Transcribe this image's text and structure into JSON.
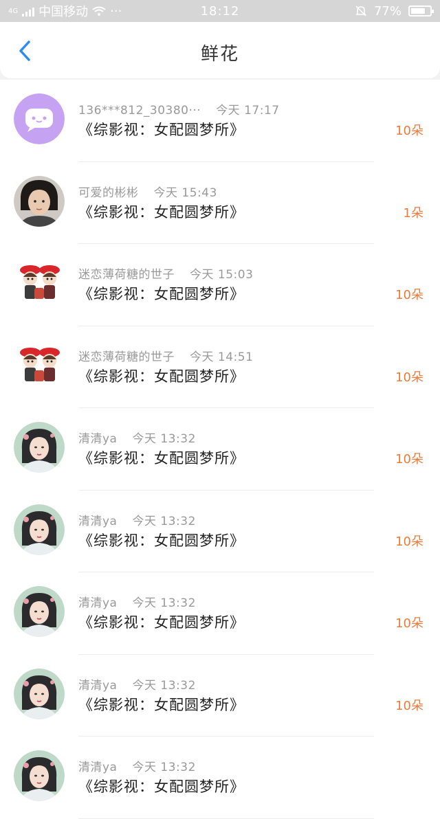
{
  "status_bar": {
    "network": "4G",
    "carrier": "中国移动",
    "dots": "···",
    "time": "18:12",
    "battery": "77%",
    "battery_level": 0.77
  },
  "header": {
    "title": "鲜花"
  },
  "records": [
    {
      "user": "136***812_30380···",
      "time": "今天 17:17",
      "book": "《综影视：女配圆梦所》",
      "count": "10朵",
      "avatar": "chat-bubble-avatar"
    },
    {
      "user": "可爱的彬彬",
      "time": "今天 15:43",
      "book": "《综影视：女配圆梦所》",
      "count": "1朵",
      "avatar": "user-photo-avatar"
    },
    {
      "user": "迷恋薄荷糖的世子",
      "time": "今天 15:03",
      "book": "《综影视：女配圆梦所》",
      "count": "10朵",
      "avatar": "cartoon-characters-avatar"
    },
    {
      "user": "迷恋薄荷糖的世子",
      "time": "今天 14:51",
      "book": "《综影视：女配圆梦所》",
      "count": "10朵",
      "avatar": "cartoon-characters-avatar"
    },
    {
      "user": "清清ya",
      "time": "今天 13:32",
      "book": "《综影视：女配圆梦所》",
      "count": "10朵",
      "avatar": "painted-lady-avatar"
    },
    {
      "user": "清清ya",
      "time": "今天 13:32",
      "book": "《综影视：女配圆梦所》",
      "count": "10朵",
      "avatar": "painted-lady-avatar"
    },
    {
      "user": "清清ya",
      "time": "今天 13:32",
      "book": "《综影视：女配圆梦所》",
      "count": "10朵",
      "avatar": "painted-lady-avatar"
    },
    {
      "user": "清清ya",
      "time": "今天 13:32",
      "book": "《综影视：女配圆梦所》",
      "count": "10朵",
      "avatar": "painted-lady-avatar"
    },
    {
      "user": "清清ya",
      "time": "今天 13:32",
      "book": "《综影视：女配圆梦所》",
      "count": "",
      "avatar": "painted-lady-avatar"
    }
  ],
  "colors": {
    "accent": "#2a8cf0",
    "count": "#ee7a3a",
    "status_bar_bg": "#d6d6d6"
  }
}
